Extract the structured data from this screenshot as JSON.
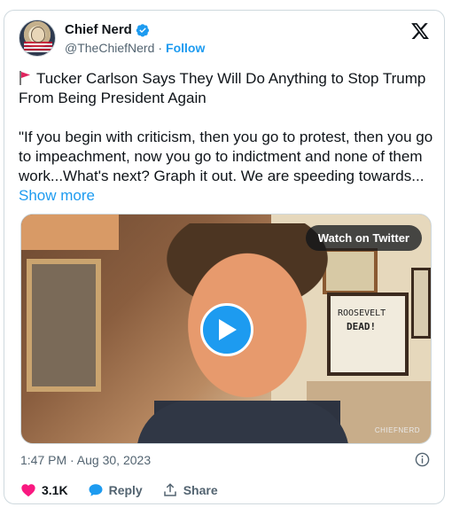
{
  "author": {
    "name": "Chief Nerd",
    "handle": "@TheChiefNerd",
    "separator": "·",
    "follow_label": "Follow"
  },
  "tweet": {
    "headline": "Tucker Carlson Says They Will Do Anything to Stop Trump From Being President Again",
    "quote": "\"If you begin with criticism, then you go to protest, then you go to impeachment, now you go to indictment and none of them work...What's next? Graph it out. We are speeding towards...",
    "show_more_label": "Show more"
  },
  "media": {
    "watch_label": "Watch on Twitter",
    "sign_line1": "ROOSEVELT",
    "sign_line2": "DEAD!",
    "watermark": "CHIEFNERD"
  },
  "footer": {
    "timestamp": "1:47 PM · Aug 30, 2023",
    "like_count": "3.1K",
    "reply_label": "Reply",
    "share_label": "Share"
  },
  "colors": {
    "accent": "#1d9bf0",
    "like": "#f91880",
    "text": "#0f1419",
    "muted": "#536471"
  },
  "icons": [
    "verified-badge-icon",
    "x-logo-icon",
    "red-flag-icon",
    "play-icon",
    "info-icon",
    "heart-icon",
    "reply-bubble-icon",
    "share-icon"
  ]
}
